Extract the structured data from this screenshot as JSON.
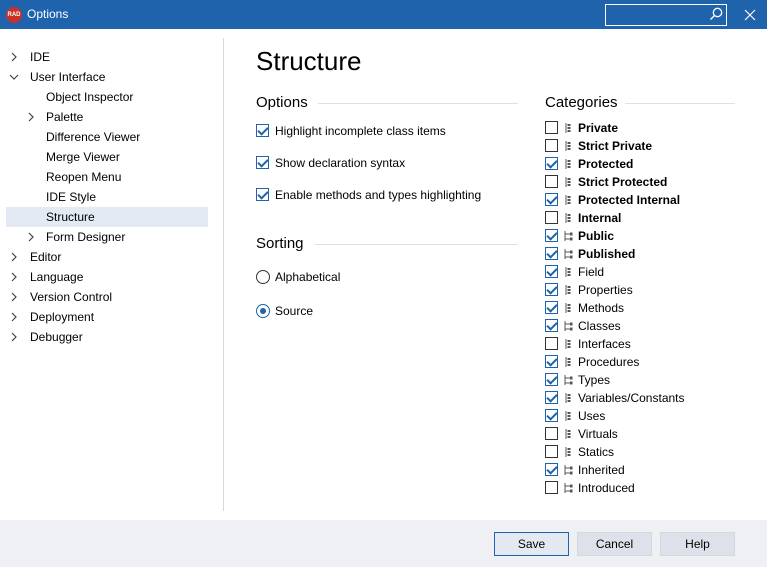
{
  "window": {
    "title": "Options",
    "app_icon": "RAD",
    "search_placeholder": ""
  },
  "sidebar": {
    "items": [
      {
        "label": "IDE",
        "expander": "collapsed"
      },
      {
        "label": "User Interface",
        "expander": "expanded"
      },
      {
        "label": "Object Inspector",
        "expander": "none"
      },
      {
        "label": "Palette",
        "expander": "collapsed"
      },
      {
        "label": "Difference Viewer",
        "expander": "none"
      },
      {
        "label": "Merge Viewer",
        "expander": "none"
      },
      {
        "label": "Reopen Menu",
        "expander": "none"
      },
      {
        "label": "IDE Style",
        "expander": "none"
      },
      {
        "label": "Structure",
        "expander": "none",
        "selected": true
      },
      {
        "label": "Form Designer",
        "expander": "collapsed"
      },
      {
        "label": "Editor",
        "expander": "collapsed"
      },
      {
        "label": "Language",
        "expander": "collapsed"
      },
      {
        "label": "Version Control",
        "expander": "collapsed"
      },
      {
        "label": "Deployment",
        "expander": "collapsed"
      },
      {
        "label": "Debugger",
        "expander": "collapsed"
      }
    ]
  },
  "main": {
    "heading": "Structure",
    "options": {
      "title": "Options",
      "items": [
        {
          "label": "Highlight incomplete class items",
          "checked": true
        },
        {
          "label": "Show declaration syntax",
          "checked": true
        },
        {
          "label": "Enable methods and types highlighting",
          "checked": true
        }
      ]
    },
    "sorting": {
      "title": "Sorting",
      "items": [
        {
          "label": "Alphabetical",
          "selected": false
        },
        {
          "label": "Source",
          "selected": true
        }
      ]
    },
    "categories": {
      "title": "Categories",
      "items": [
        {
          "label": "Private",
          "checked": false,
          "bold": true,
          "icon": "member-icon"
        },
        {
          "label": "Strict Private",
          "checked": false,
          "bold": true,
          "icon": "member-icon"
        },
        {
          "label": "Protected",
          "checked": true,
          "bold": true,
          "icon": "member-icon"
        },
        {
          "label": "Strict Protected",
          "checked": false,
          "bold": true,
          "icon": "member-icon"
        },
        {
          "label": "Protected Internal",
          "checked": true,
          "bold": true,
          "icon": "member-icon"
        },
        {
          "label": "Internal",
          "checked": false,
          "bold": true,
          "icon": "member-icon"
        },
        {
          "label": "Public",
          "checked": true,
          "bold": true,
          "icon": "tree-icon"
        },
        {
          "label": "Published",
          "checked": true,
          "bold": true,
          "icon": "tree-icon"
        },
        {
          "label": "Field",
          "checked": true,
          "bold": false,
          "icon": "member-icon"
        },
        {
          "label": "Properties",
          "checked": true,
          "bold": false,
          "icon": "member-icon"
        },
        {
          "label": "Methods",
          "checked": true,
          "bold": false,
          "icon": "member-icon"
        },
        {
          "label": "Classes",
          "checked": true,
          "bold": false,
          "icon": "tree-icon"
        },
        {
          "label": "Interfaces",
          "checked": false,
          "bold": false,
          "icon": "member-icon"
        },
        {
          "label": "Procedures",
          "checked": true,
          "bold": false,
          "icon": "member-icon"
        },
        {
          "label": "Types",
          "checked": true,
          "bold": false,
          "icon": "tree-icon"
        },
        {
          "label": "Variables/Constants",
          "checked": true,
          "bold": false,
          "icon": "member-icon"
        },
        {
          "label": "Uses",
          "checked": true,
          "bold": false,
          "icon": "member-icon"
        },
        {
          "label": "Virtuals",
          "checked": false,
          "bold": false,
          "icon": "member-icon"
        },
        {
          "label": "Statics",
          "checked": false,
          "bold": false,
          "icon": "member-icon"
        },
        {
          "label": "Inherited",
          "checked": true,
          "bold": false,
          "icon": "tree-icon"
        },
        {
          "label": "Introduced",
          "checked": false,
          "bold": false,
          "icon": "tree-icon"
        }
      ]
    }
  },
  "footer": {
    "save": "Save",
    "cancel": "Cancel",
    "help": "Help"
  },
  "colors": {
    "titlebar": "#1f63ad",
    "accent": "#1f63ad",
    "selection": "#e4eaf4",
    "footer": "#eef0f4"
  }
}
